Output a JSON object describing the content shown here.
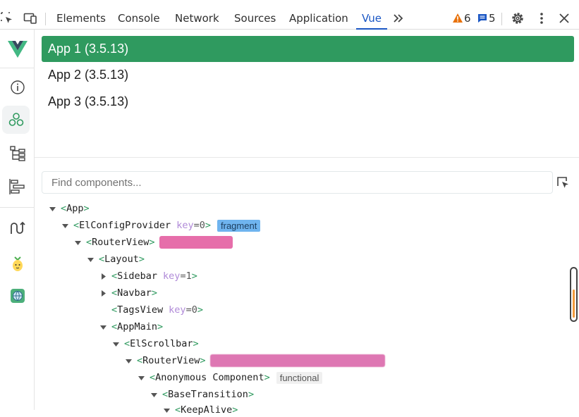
{
  "devtools": {
    "tabs": [
      "Elements",
      "Console",
      "Network",
      "Sources",
      "Application",
      "Vue"
    ],
    "active_tab": "Vue",
    "warnings_count": "6",
    "messages_count": "5",
    "colors": {
      "accent": "#1a56c4",
      "warning": "#e8710a",
      "message": "#1a56c4"
    }
  },
  "sidebar": {
    "icons": [
      "vue-logo-icon",
      "info-icon",
      "components-icon",
      "tree-icon",
      "timeline-icon",
      "routes-icon",
      "pinia-icon",
      "globe-icon"
    ]
  },
  "apps": {
    "items": [
      {
        "label": "App 1 (3.5.13)",
        "active": true
      },
      {
        "label": "App 2 (3.5.13)",
        "active": false
      },
      {
        "label": "App 3 (3.5.13)",
        "active": false
      }
    ],
    "active_color": "#2f9a5f"
  },
  "search": {
    "placeholder": "Find components..."
  },
  "tree": {
    "nodes": [
      {
        "name": "App",
        "depth": 0,
        "expanded": true
      },
      {
        "name": "ElConfigProvider",
        "depth": 1,
        "expanded": true,
        "key": "0",
        "badge": "fragment"
      },
      {
        "name": "RouterView",
        "depth": 2,
        "expanded": true,
        "redacted": true
      },
      {
        "name": "Layout",
        "depth": 3,
        "expanded": true
      },
      {
        "name": "Sidebar",
        "depth": 4,
        "expanded": false,
        "key": "1"
      },
      {
        "name": "Navbar",
        "depth": 4,
        "expanded": false
      },
      {
        "name": "TagsView",
        "depth": 4,
        "leaf": true,
        "key": "0"
      },
      {
        "name": "AppMain",
        "depth": 4,
        "expanded": true
      },
      {
        "name": "ElScrollbar",
        "depth": 5,
        "expanded": true
      },
      {
        "name": "RouterView",
        "depth": 6,
        "expanded": true,
        "redacted": true
      },
      {
        "name": "Anonymous Component",
        "depth": 7,
        "expanded": true,
        "badge": "functional"
      },
      {
        "name": "BaseTransition",
        "depth": 8,
        "expanded": true
      },
      {
        "name": "KeepAlive",
        "depth": 9,
        "expanded": true
      }
    ]
  }
}
